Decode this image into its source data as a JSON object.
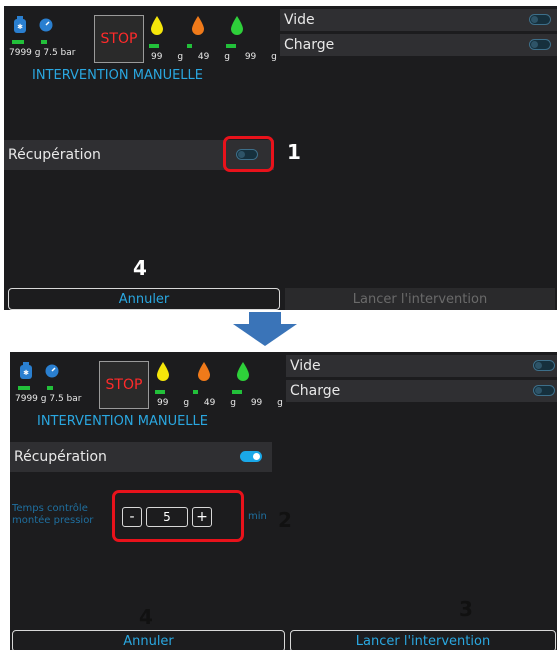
{
  "screen_before": {
    "gauges": [
      "7999 g",
      "7.5 bar"
    ],
    "stop_label": "STOP",
    "fluids": [
      "99 g",
      "49 g",
      "99 g"
    ],
    "title": "INTERVENTION MANUELLE",
    "options": [
      {
        "label": "Vide",
        "on": false
      },
      {
        "label": "Charge",
        "on": false
      }
    ],
    "recuperation": {
      "label": "Récupération",
      "on": false
    },
    "cancel_label": "Annuler",
    "launch_label": "Lancer l'intervention",
    "launch_enabled": false
  },
  "screen_after": {
    "gauges": [
      "7999 g",
      "7.5 bar"
    ],
    "stop_label": "STOP",
    "fluids": [
      "99 g",
      "49 g",
      "99 g"
    ],
    "title": "INTERVENTION MANUELLE",
    "options": [
      {
        "label": "Vide",
        "on": false
      },
      {
        "label": "Charge",
        "on": false
      }
    ],
    "recuperation": {
      "label": "Récupération",
      "on": true
    },
    "pressure_control": {
      "label_line1": "Temps contrôle",
      "label_line2": "montée pressior",
      "decrement": "-",
      "value": "5",
      "increment": "+",
      "unit": "min"
    },
    "cancel_label": "Annuler",
    "launch_label": "Lancer l'intervention",
    "launch_enabled": true
  },
  "callouts": [
    "1",
    "2",
    "3",
    "4",
    "4"
  ],
  "colors": {
    "accent": "#2aa7e0",
    "highlight": "#e8121b",
    "level": "#22c03a",
    "stop": "#ff2a2a"
  }
}
